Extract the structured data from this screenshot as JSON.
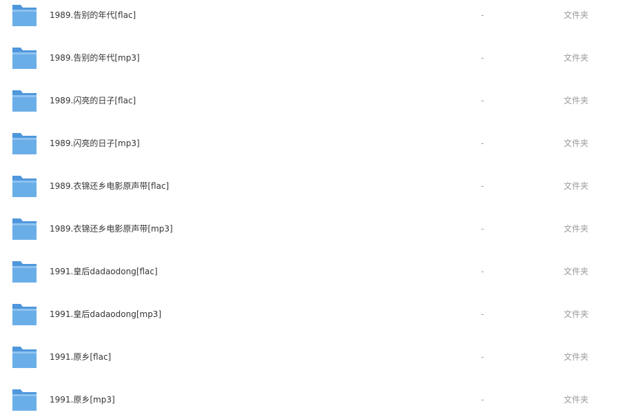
{
  "files": [
    {
      "name": "1989.告别的年代[flac]",
      "size": "-",
      "type": "文件夹",
      "icon": "folder-icon"
    },
    {
      "name": "1989.告别的年代[mp3]",
      "size": "-",
      "type": "文件夹",
      "icon": "folder-icon"
    },
    {
      "name": "1989.闪亮的日子[flac]",
      "size": "-",
      "type": "文件夹",
      "icon": "folder-icon"
    },
    {
      "name": "1989.闪亮的日子[mp3]",
      "size": "-",
      "type": "文件夹",
      "icon": "folder-icon"
    },
    {
      "name": "1989.衣锦还乡电影原声带[flac]",
      "size": "-",
      "type": "文件夹",
      "icon": "folder-icon"
    },
    {
      "name": "1989.衣锦还乡电影原声带[mp3]",
      "size": "-",
      "type": "文件夹",
      "icon": "folder-icon"
    },
    {
      "name": "1991.皇后dadaodong[flac]",
      "size": "-",
      "type": "文件夹",
      "icon": "folder-icon"
    },
    {
      "name": "1991.皇后dadaodong[mp3]",
      "size": "-",
      "type": "文件夹",
      "icon": "folder-icon"
    },
    {
      "name": "1991.原乡[flac]",
      "size": "-",
      "type": "文件夹",
      "icon": "folder-icon"
    },
    {
      "name": "1991.原乡[mp3]",
      "size": "-",
      "type": "文件夹",
      "icon": "folder-icon"
    }
  ],
  "colors": {
    "folder_front": "#6aaee8",
    "folder_back": "#4f97dc",
    "folder_light": "#a9d1f5"
  }
}
